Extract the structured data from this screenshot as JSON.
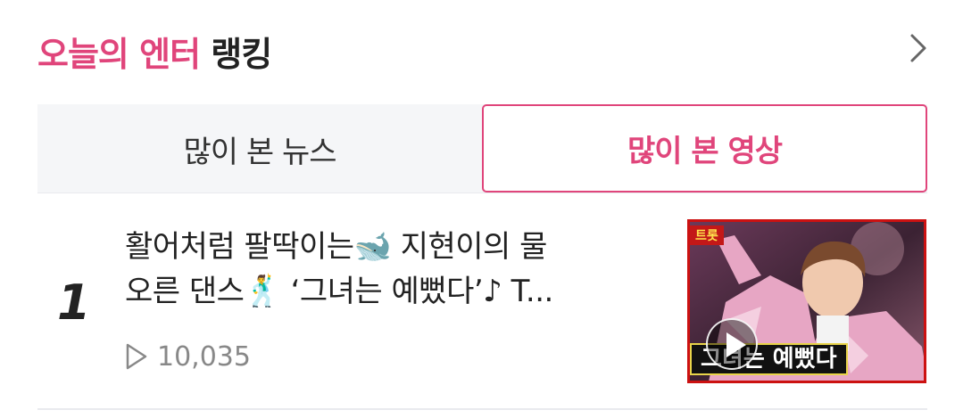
{
  "header": {
    "title_accent": "오늘의 엔터",
    "title_rest": "랭킹",
    "more_icon": "chevron-right-icon"
  },
  "tabs": [
    {
      "label": "많이 본 뉴스",
      "active": false
    },
    {
      "label": "많이 본 영상",
      "active": true
    }
  ],
  "ranking": {
    "items": [
      {
        "rank": "1",
        "title_line1": "활어처럼 팔딱이는🐋 지현이의 물",
        "title_line2": "오른 댄스🕺 ‘그녀는 예뻤다’♪ T...",
        "views": "10,035",
        "views_icon": "play-outline-icon",
        "thumbnail": {
          "tag": "트롯",
          "caption": "그녀는 예뻤다",
          "play_icon": "play-icon"
        }
      }
    ]
  },
  "colors": {
    "accent": "#e0457b",
    "tab_bg": "#f5f6f8",
    "thumb_border": "#cc1111"
  }
}
